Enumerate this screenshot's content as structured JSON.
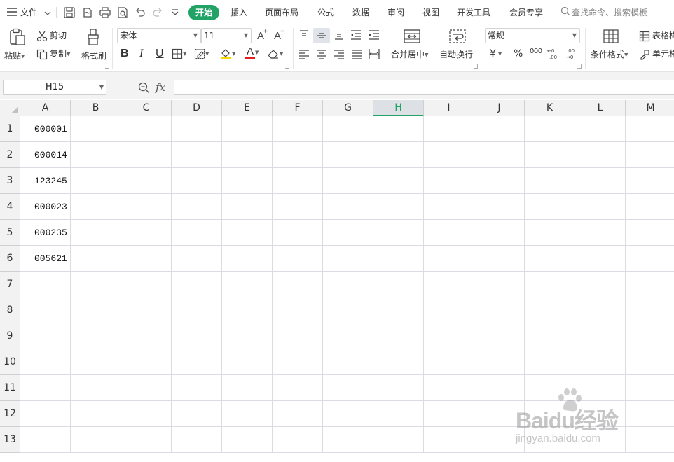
{
  "menubar": {
    "file_menu": "文件",
    "tabs": [
      "开始",
      "插入",
      "页面布局",
      "公式",
      "数据",
      "审阅",
      "视图",
      "开发工具",
      "会员专享"
    ],
    "search_placeholder": "查找命令、搜索模板"
  },
  "ribbon": {
    "paste": "粘贴",
    "cut": "剪切",
    "copy": "复制",
    "format_painter": "格式刷",
    "font_name": "宋体",
    "font_size": "11",
    "merge_center": "合并居中",
    "wrap_text": "自动换行",
    "number_format": "常规",
    "currency_symbol": "¥",
    "percent_symbol": "%",
    "thousands_symbol": "000",
    "conditional_format": "条件格式",
    "table_style": "表格样",
    "cell_style": "单元格",
    "bold": "B",
    "italic": "I",
    "underline": "U",
    "font_color_letter": "A",
    "font_color": "#e02020",
    "fill_color": "#f7d900",
    "accent_color": "#21a366"
  },
  "formula_bar": {
    "name_box": "H15",
    "fx_label": "fx",
    "formula": ""
  },
  "sheet": {
    "columns": [
      "A",
      "B",
      "C",
      "D",
      "E",
      "F",
      "G",
      "H",
      "I",
      "J",
      "K",
      "L",
      "M"
    ],
    "rows": [
      "1",
      "2",
      "3",
      "4",
      "5",
      "6",
      "7",
      "8",
      "9",
      "10",
      "11",
      "12",
      "13"
    ],
    "selected_column": "H",
    "column_a_values": [
      "000001",
      "000014",
      "123245",
      "000023",
      "000235",
      "005621"
    ]
  },
  "watermark": {
    "brand": "Baidu经验",
    "url": "jingyan.baidu.com"
  }
}
